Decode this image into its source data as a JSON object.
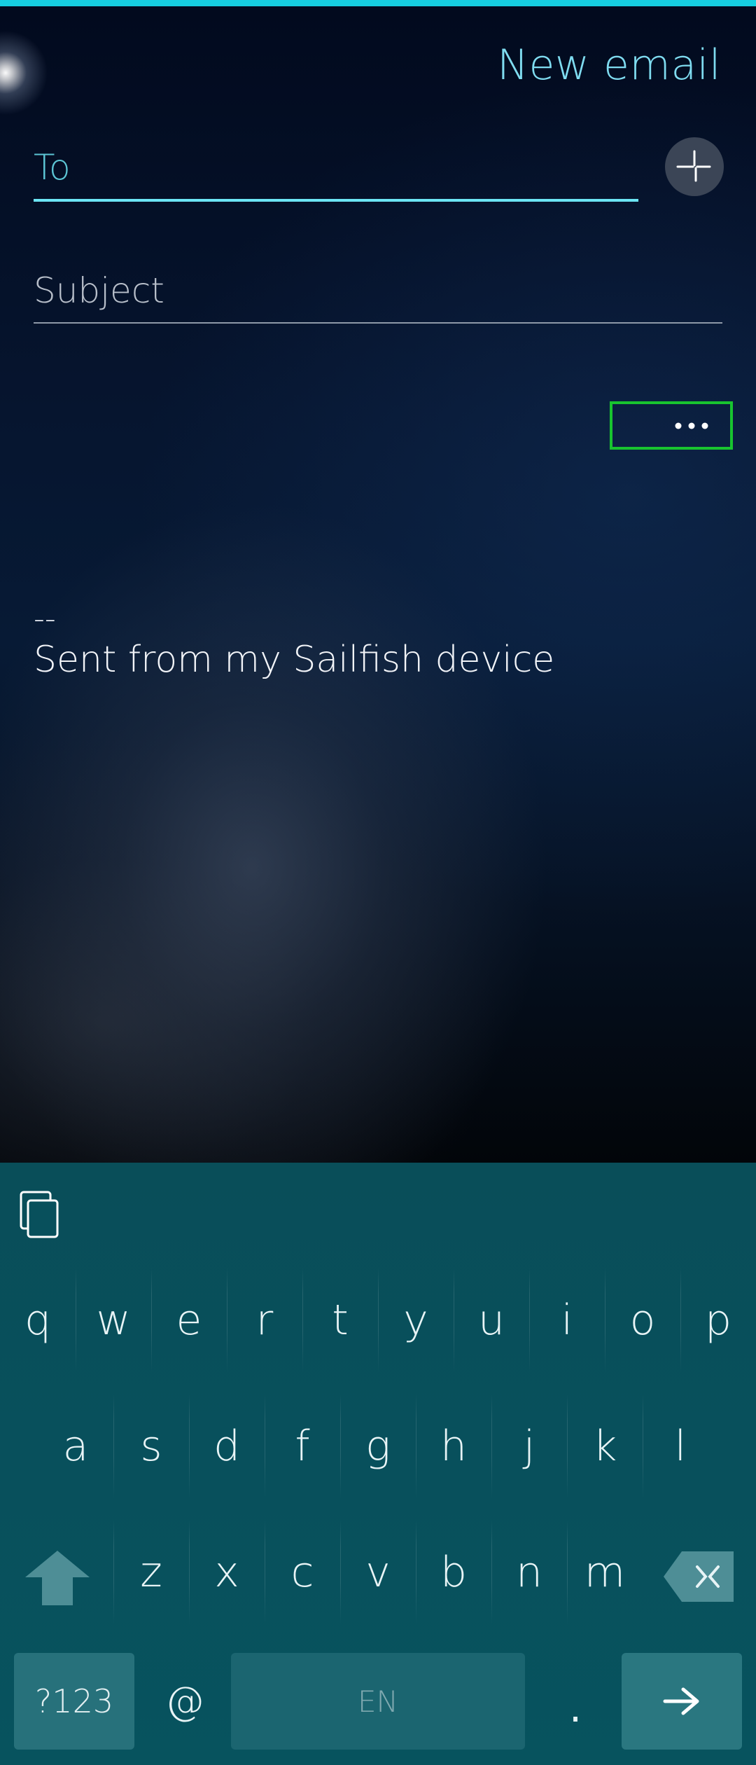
{
  "header": {
    "title": "New email"
  },
  "compose": {
    "to_placeholder": "To",
    "subject_placeholder": "Subject",
    "more_button_label": "•••",
    "signature_separator": "--",
    "signature_text": "Sent from my Sailfish device"
  },
  "icons": {
    "add_contact": "add-contact-icon",
    "more": "ellipsis-icon",
    "clipboard": "clipboard-icon",
    "shift": "shift-arrow-icon",
    "backspace": "backspace-icon",
    "enter": "arrow-right-icon"
  },
  "keyboard": {
    "row1": [
      "q",
      "w",
      "e",
      "r",
      "t",
      "y",
      "u",
      "i",
      "o",
      "p"
    ],
    "row2": [
      "a",
      "s",
      "d",
      "f",
      "g",
      "h",
      "j",
      "k",
      "l"
    ],
    "row3": [
      "z",
      "x",
      "c",
      "v",
      "b",
      "n",
      "m"
    ],
    "symbols_label": "?123",
    "at_label": "@",
    "space_label": "EN",
    "period_label": "."
  },
  "colors": {
    "accent": "#6ce5f4",
    "top_strip": "#16cde0",
    "highlight_box": "#18c42f",
    "keyboard_bg": "#08505c"
  }
}
